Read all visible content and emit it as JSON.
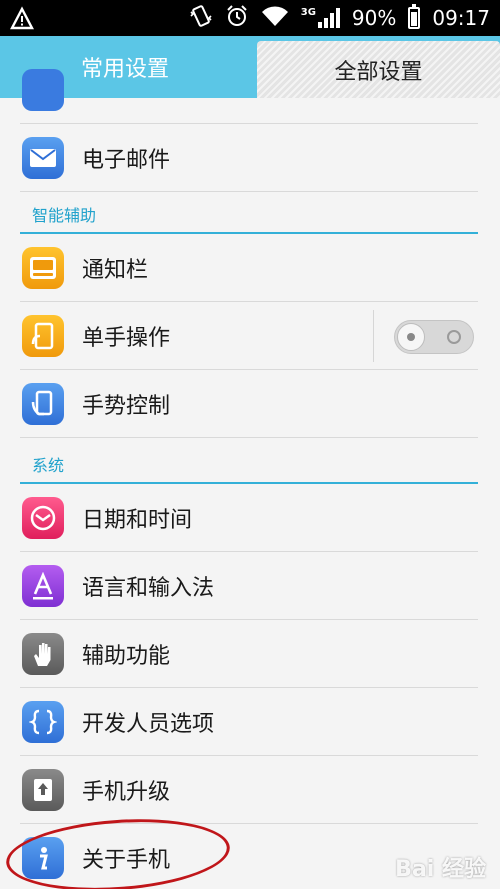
{
  "statusbar": {
    "network_type": "3G",
    "battery": "90%",
    "time": "09:17"
  },
  "tabs": {
    "common": "常用设置",
    "all": "全部设置"
  },
  "items": {
    "email": "电子邮件",
    "notification": "通知栏",
    "one_hand": "单手操作",
    "gesture": "手势控制",
    "datetime": "日期和时间",
    "language": "语言和输入法",
    "accessibility": "辅助功能",
    "developer": "开发人员选项",
    "update": "手机升级",
    "about": "关于手机"
  },
  "sections": {
    "smart_assist": "智能辅助",
    "system": "系统"
  },
  "watermark": "Bai 经验",
  "colors": {
    "accent": "#5bc6e6",
    "section_text": "#21a2cc"
  }
}
